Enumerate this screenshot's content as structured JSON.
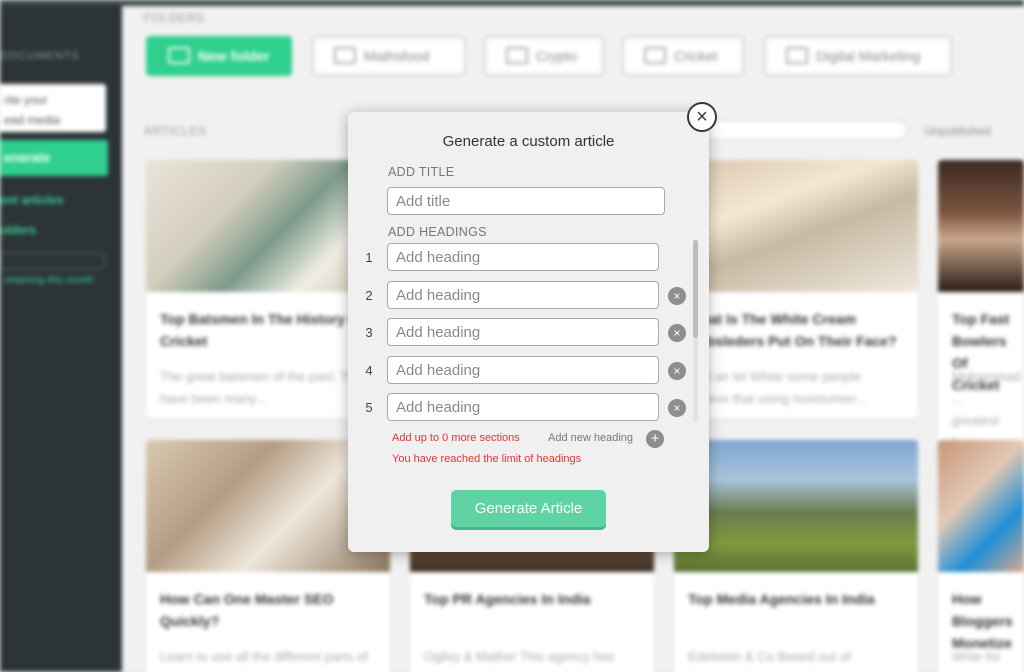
{
  "app": {
    "sidebar": {
      "brand": "DOCUMENTS",
      "box_text": [
        "rite your",
        "ead media"
      ],
      "button": "enerate",
      "links": [
        "ent articles",
        "olders"
      ],
      "small": "ontaining this month"
    },
    "folders": {
      "label": "FOLDERS",
      "items": [
        "New folder",
        "Mathsfood",
        "Crypto",
        "Cricket",
        "Digital Marketing"
      ]
    },
    "articles": {
      "label": "ARTICLES",
      "filter": "Unpublished",
      "cards": [
        {
          "title": "Top Batsmen In The History Of Cricket",
          "excerpt": "The great batsmen of the past. There have been many..."
        },
        {
          "title": "",
          "excerpt": ""
        },
        {
          "title": "What Is The White Cream Bobsleders Put On Their Face?",
          "excerpt": "Bad air let White some people believe that using moisturiser..."
        },
        {
          "title": "Top Fast Bowlers Of Cricket",
          "excerpt": "Mohammad ... greatest fast..."
        },
        {
          "title": "How Can One Master SEO Quickly?",
          "excerpt": "Learn to use all the different parts of the algorithm fo..."
        },
        {
          "title": "Top PR Agencies In India",
          "excerpt": "Ogilvy & Mather This agency has been representing brands for..."
        },
        {
          "title": "Top Media Agencies In India",
          "excerpt": "Edelstein & Co Based out of Mumbai, Edelstein & Company..."
        },
        {
          "title": "How Bloggers Monetize",
          "excerpt": "Write for money..."
        }
      ]
    }
  },
  "modal": {
    "title": "Generate a custom article",
    "title_label": "ADD TITLE",
    "title_placeholder": "Add title",
    "headings_label": "ADD HEADINGS",
    "headings": [
      {
        "num": "1",
        "placeholder": "Add heading"
      },
      {
        "num": "2",
        "placeholder": "Add heading"
      },
      {
        "num": "3",
        "placeholder": "Add heading"
      },
      {
        "num": "4",
        "placeholder": "Add heading"
      },
      {
        "num": "5",
        "placeholder": "Add heading"
      }
    ],
    "remove_glyph": "×",
    "sections_note": "Add up to 0 more sections",
    "add_new_heading": "Add new heading",
    "add_glyph": "+",
    "limit_warning": "You have reached the limit of headings",
    "generate_button": "Generate Article",
    "close_glyph": "×"
  },
  "colors": {
    "accent": "#5fd3a3",
    "error": "#e0373c",
    "sidebar": "#2c3438"
  }
}
